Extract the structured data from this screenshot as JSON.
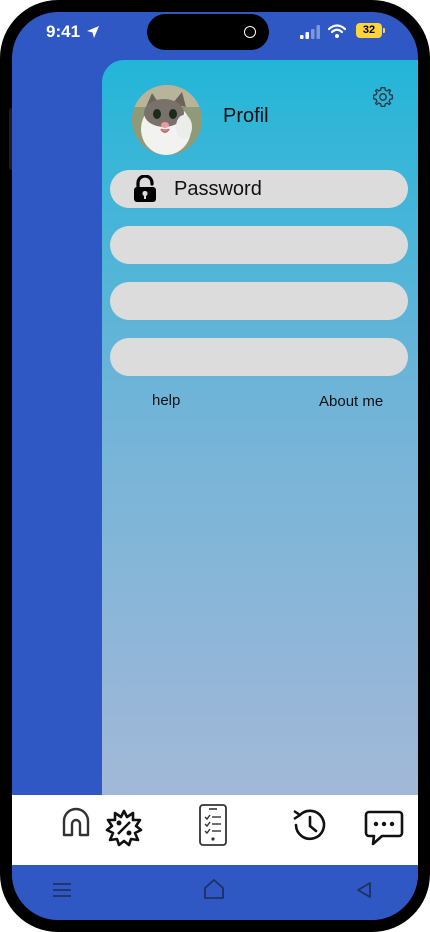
{
  "status_bar": {
    "time": "9:41",
    "battery": "32"
  },
  "profile": {
    "label": "Profil"
  },
  "fields": [
    {
      "label": "Password",
      "icon": "unlocked-lock-icon"
    },
    {
      "label": ""
    },
    {
      "label": ""
    },
    {
      "label": ""
    }
  ],
  "links": {
    "help": "help",
    "about": "About me"
  },
  "bottom_nav": {
    "items": [
      "home-icon",
      "badge-percent-icon",
      "checklist-phone-icon",
      "history-clock-icon",
      "chat-bubble-icon"
    ]
  },
  "system_nav": {
    "items": [
      "menu-icon",
      "home-icon",
      "back-icon"
    ]
  },
  "colors": {
    "background_blue": "#3058c4",
    "panel_gradient_top": "#22b6d8",
    "panel_gradient_bottom": "#a6b8d8",
    "field_gray": "#dcdcdc",
    "battery_yellow": "#ffd43b"
  }
}
